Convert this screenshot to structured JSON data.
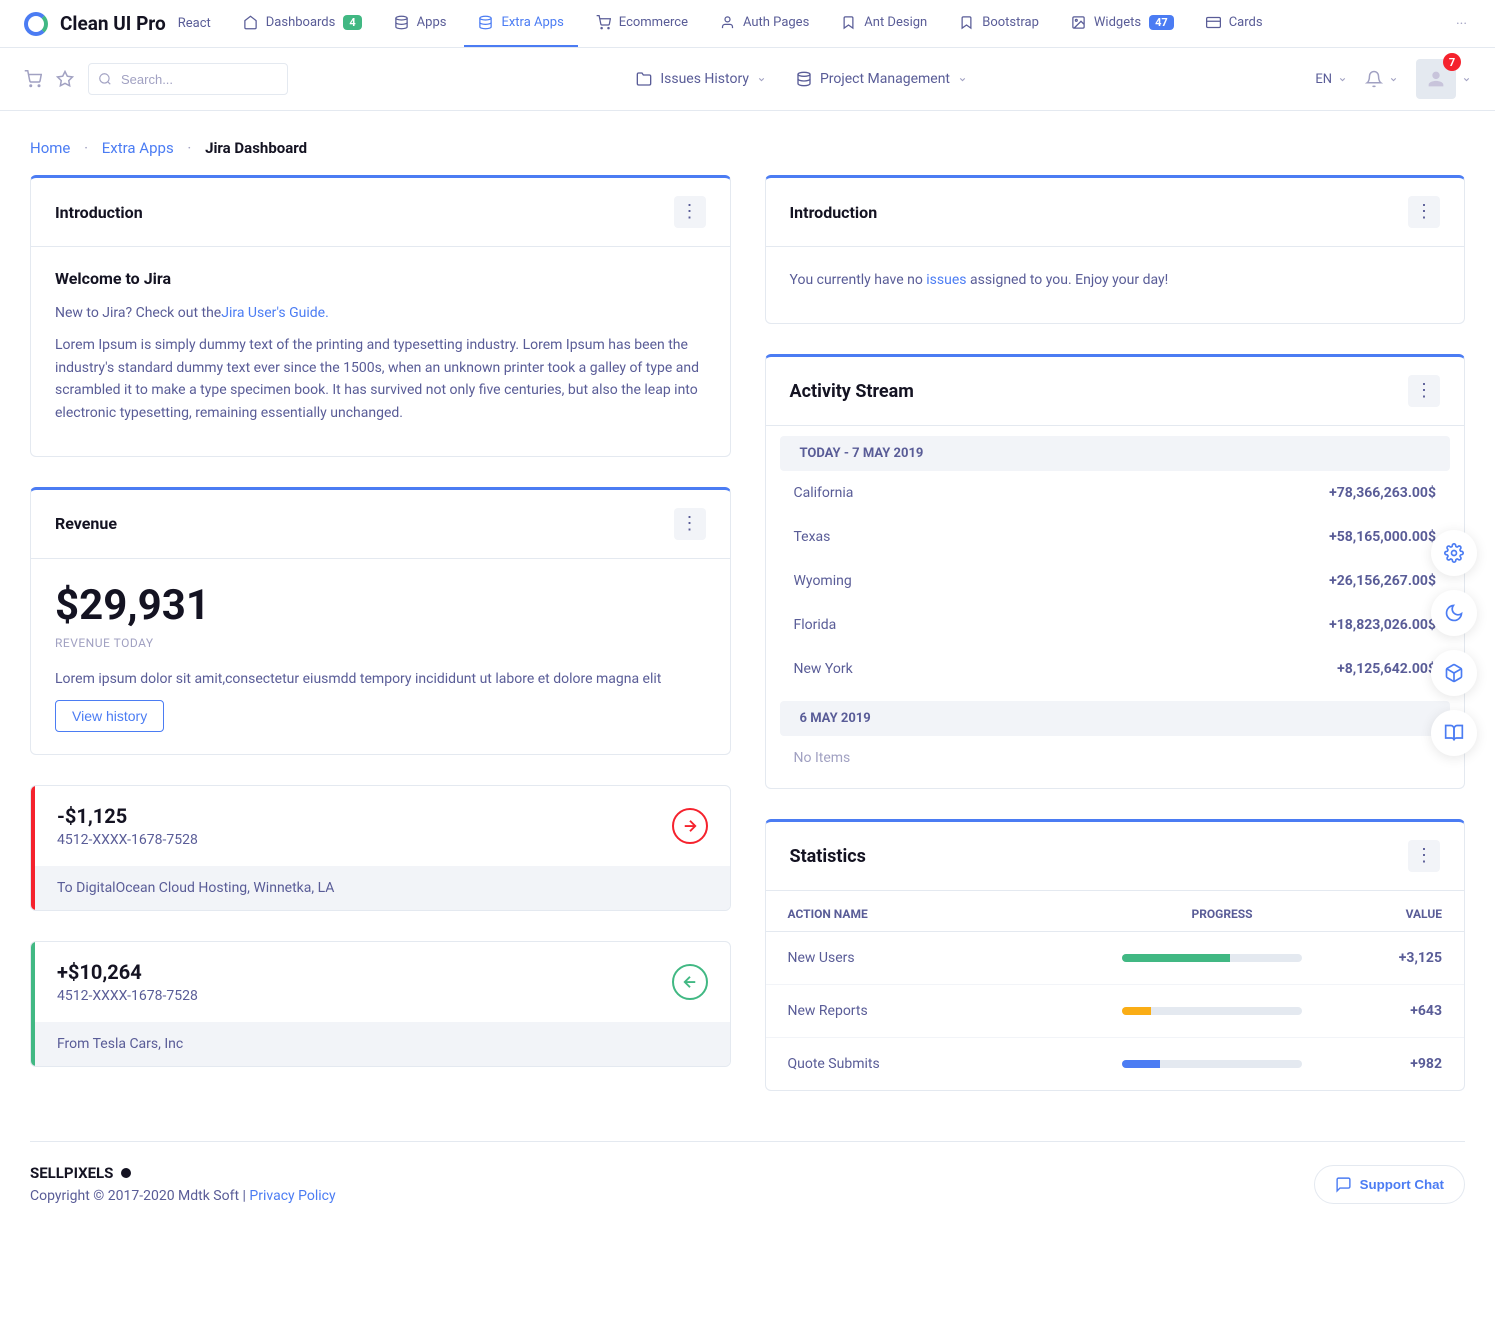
{
  "logo": {
    "title": "Clean UI Pro",
    "sub": "React"
  },
  "nav": [
    {
      "label": "Dashboards",
      "badge": "4",
      "badgeColor": "green"
    },
    {
      "label": "Apps"
    },
    {
      "label": "Extra Apps",
      "active": true
    },
    {
      "label": "Ecommerce"
    },
    {
      "label": "Auth Pages"
    },
    {
      "label": "Ant Design"
    },
    {
      "label": "Bootstrap"
    },
    {
      "label": "Widgets",
      "badge": "47",
      "badgeColor": "blue"
    },
    {
      "label": "Cards"
    }
  ],
  "search": {
    "placeholder": "Search..."
  },
  "centerLinks": [
    {
      "label": "Issues History"
    },
    {
      "label": "Project Management"
    }
  ],
  "lang": "EN",
  "notif_count": "7",
  "breadcrumb": {
    "items": [
      "Home",
      "Extra Apps"
    ],
    "current": "Jira Dashboard"
  },
  "introCard": {
    "title": "Introduction",
    "heading": "Welcome to Jira",
    "lead_pre": "New to Jira? Check out the",
    "lead_link": "Jira User's Guide.",
    "body": "Lorem Ipsum is simply dummy text of the printing and typesetting industry. Lorem Ipsum has been the industry's standard dummy text ever since the 1500s, when an unknown printer took a galley of type and scrambled it to make a type specimen book. It has survived not only five centuries, but also the leap into electronic typesetting, remaining essentially unchanged."
  },
  "issuesCard": {
    "title": "Introduction",
    "text_pre": "You currently have no ",
    "link": "issues",
    "text_post": " assigned to you. Enjoy your day!"
  },
  "revenueCard": {
    "title": "Revenue",
    "amount": "$29,931",
    "label": "REVENUE TODAY",
    "desc": "Lorem ipsum dolor sit amit,consectetur eiusmdd tempory incididunt ut labore et dolore magna elit",
    "button": "View history"
  },
  "tx1": {
    "amount": "-$1,125",
    "card": "4512-XXXX-1678-7528",
    "desc": "To DigitalOcean Cloud Hosting, Winnetka, LA"
  },
  "tx2": {
    "amount": "+$10,264",
    "card": "4512-XXXX-1678-7528",
    "desc": "From Tesla Cars, Inc"
  },
  "activity": {
    "title": "Activity Stream",
    "today_label": "TODAY - 7 MAY 2019",
    "today": [
      {
        "place": "California",
        "value": "+78,366,263.00$"
      },
      {
        "place": "Texas",
        "value": "+58,165,000.00$"
      },
      {
        "place": "Wyoming",
        "value": "+26,156,267.00$"
      },
      {
        "place": "Florida",
        "value": "+18,823,026.00$"
      },
      {
        "place": "New York",
        "value": "+8,125,642.00$"
      }
    ],
    "prev_label": "6 MAY 2019",
    "prev_empty": "No Items"
  },
  "stats": {
    "title": "Statistics",
    "headers": {
      "action": "ACTION NAME",
      "progress": "PROGRESS",
      "value": "VALUE"
    },
    "rows": [
      {
        "name": "New Users",
        "pct": 60,
        "color": "green",
        "value": "+3,125"
      },
      {
        "name": "New Reports",
        "pct": 16,
        "color": "orange",
        "value": "+643"
      },
      {
        "name": "Quote Submits",
        "pct": 21,
        "color": "blue",
        "value": "+982"
      }
    ]
  },
  "footer": {
    "brand": "SELLPIXELS",
    "copyright": "Copyright © 2017-2020 Mdtk Soft | ",
    "privacy": "Privacy Policy",
    "support": "Support Chat"
  }
}
